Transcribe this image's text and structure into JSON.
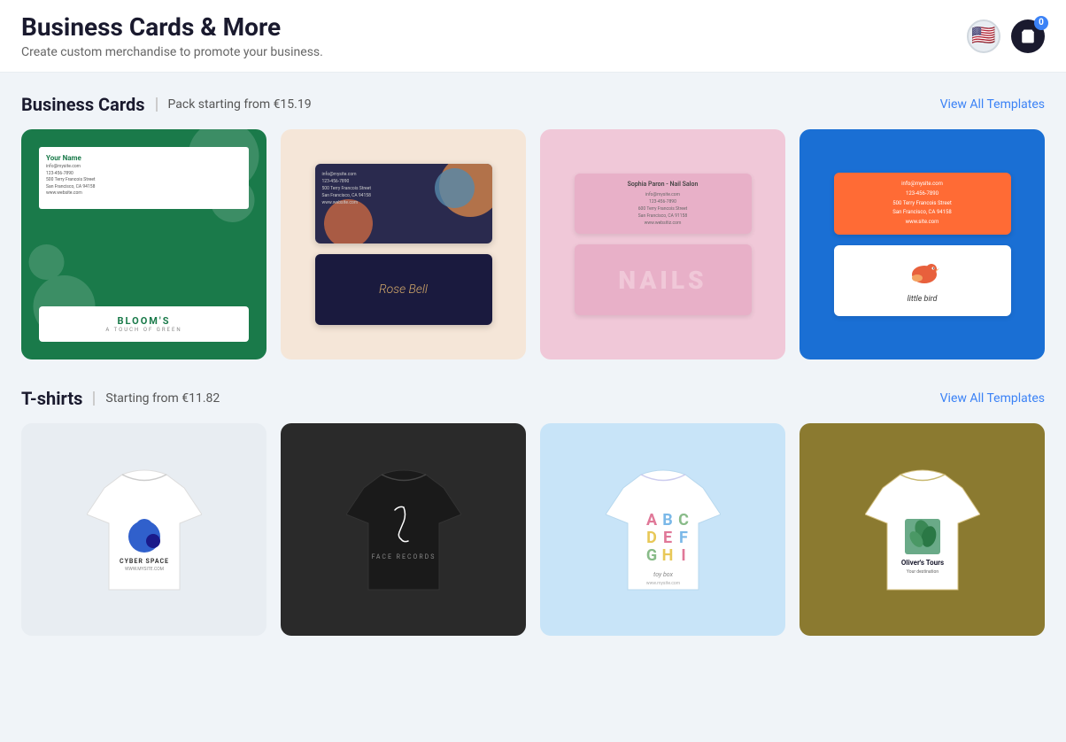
{
  "header": {
    "title": "Business Cards & More",
    "subtitle": "Create custom merchandise to promote your business.",
    "flag": "🇺🇸",
    "cart_count": "0"
  },
  "sections": {
    "business_cards": {
      "title": "Business Cards",
      "price_label": "Pack starting from €15.19",
      "view_all": "View All Templates",
      "items": [
        {
          "id": "bc-green",
          "alt": "Bloom's green business card"
        },
        {
          "id": "bc-dark",
          "alt": "Rose Bell dark business card"
        },
        {
          "id": "bc-nails",
          "alt": "Nails pink business card"
        },
        {
          "id": "bc-bird",
          "alt": "Little Bird blue business card"
        }
      ]
    },
    "tshirts": {
      "title": "T-shirts",
      "price_label": "Starting from €11.82",
      "view_all": "View All Templates",
      "items": [
        {
          "id": "ts-cyber",
          "alt": "Cyber Space white t-shirt"
        },
        {
          "id": "ts-face",
          "alt": "Face Records black t-shirt"
        },
        {
          "id": "ts-abc",
          "alt": "ABC toy box t-shirt"
        },
        {
          "id": "ts-olivers",
          "alt": "Oliver's Tours t-shirt"
        }
      ]
    }
  },
  "colors": {
    "green_bg": "#1a7a4a",
    "blue_accent": "#3b82f6",
    "card_blue": "#1a6fd4",
    "nails_pink": "#f0c8d8",
    "orange_accent": "#ff6b35",
    "dark_bg": "#1a1a2e"
  }
}
